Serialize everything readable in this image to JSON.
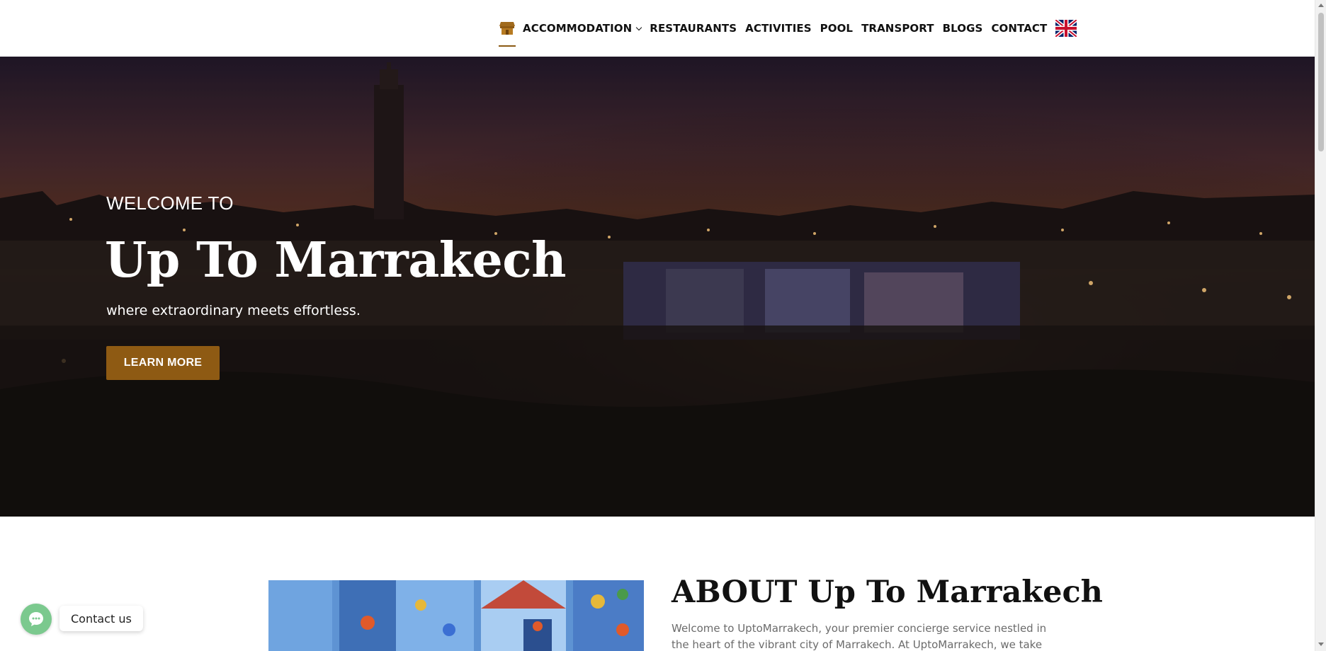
{
  "nav": {
    "items": [
      {
        "label": "ACCOMMODATION",
        "has_dropdown": true
      },
      {
        "label": "RESTAURANTS"
      },
      {
        "label": "ACTIVITIES"
      },
      {
        "label": "POOL"
      },
      {
        "label": "TRANSPORT"
      },
      {
        "label": "BLOGS"
      },
      {
        "label": "CONTACT"
      }
    ],
    "home_icon": "shop-icon",
    "language_icon": "uk-flag-icon"
  },
  "hero": {
    "welcome": "WELCOME TO",
    "title": "Up To Marrakech",
    "tagline": "where extraordinary meets effortless.",
    "button_label": "LEARN MORE"
  },
  "about": {
    "title": "ABOUT Up To Marrakech",
    "text": "Welcome to UptoMarrakech, your premier concierge service nestled in the heart of the vibrant city of Marrakech. At UptoMarrakech, we take"
  },
  "contact_widget": {
    "label": "Contact us",
    "icon": "chat-icon"
  },
  "colors": {
    "accent": "#8e5a13",
    "contact_green": "#7bc98e"
  }
}
